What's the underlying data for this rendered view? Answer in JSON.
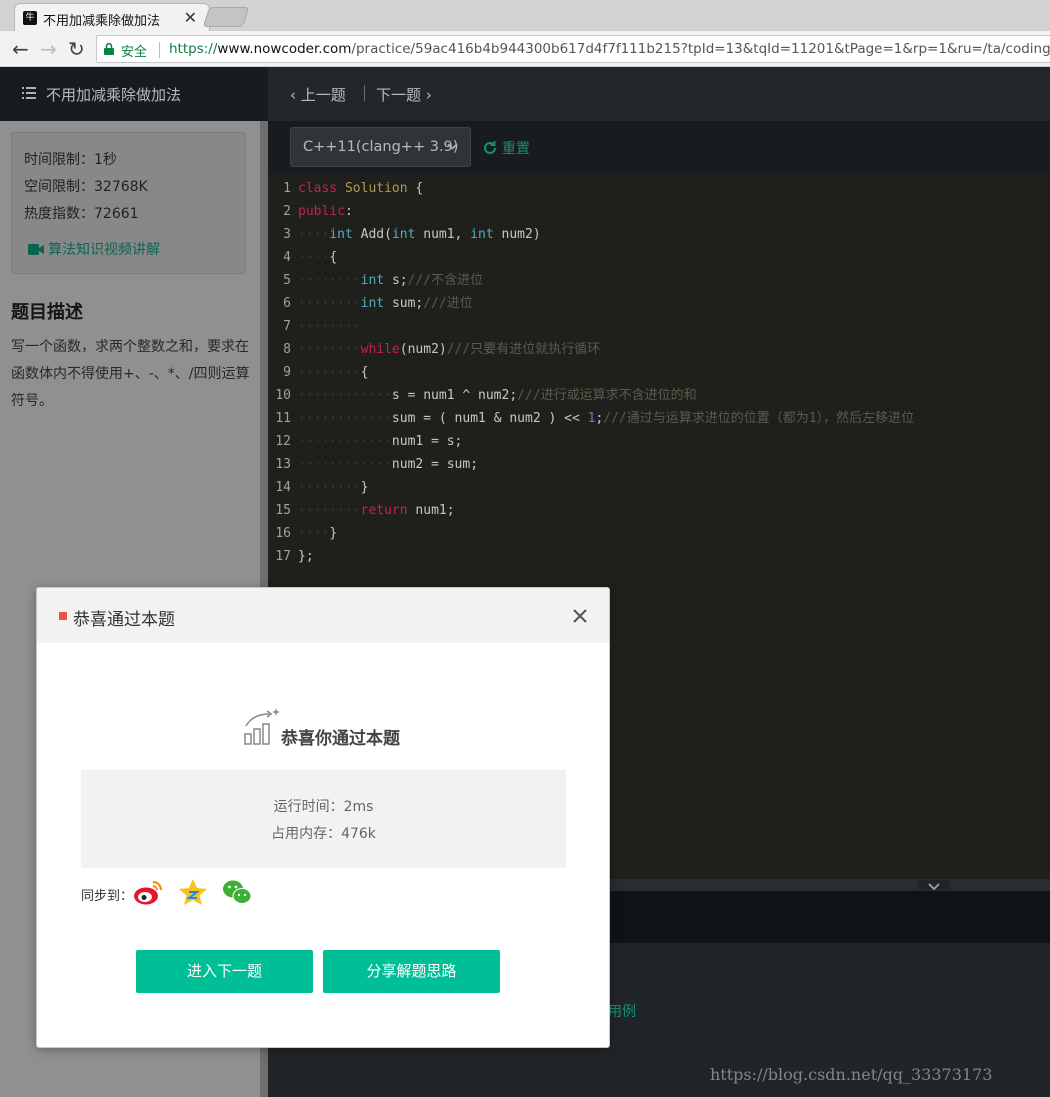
{
  "browser": {
    "tab_title": "不用加减乘除做加法",
    "tab_favicon": "牛",
    "secure_label": "安全",
    "url_scheme": "https://",
    "url_host": "www.nowcoder.com",
    "url_path": "/practice/59ac416b4b944300b617d4f7f111b215?tpId=13&tqId=11201&tPage=1&rp=1&ru=/ta/coding"
  },
  "left_panel": {
    "title": "不用加减乘除做加法",
    "time_limit": "时间限制：1秒",
    "space_limit": "空间限制：32768K",
    "heat_index": "热度指数：72661",
    "video_link": "算法知识视频讲解",
    "desc_title": "题目描述",
    "desc_text": "写一个函数，求两个整数之和，要求在函数体内不得使用+、-、*、/四则运算符号。"
  },
  "right_panel": {
    "prev_label": "上一题",
    "next_label": "下一题",
    "language": "C++11(clang++ 3.9)",
    "reset_label": "重置",
    "example_fragment": "用例"
  },
  "code_lines": [
    [
      [
        "k",
        "class"
      ],
      [
        "d",
        " "
      ],
      [
        "cls",
        "Solution"
      ],
      [
        "d",
        " "
      ],
      [
        "p",
        "{"
      ]
    ],
    [
      [
        "k",
        "public"
      ],
      [
        "p",
        ":"
      ]
    ],
    [
      [
        "d",
        "····"
      ],
      [
        "t",
        "int"
      ],
      [
        "d",
        " "
      ],
      [
        "p",
        "Add("
      ],
      [
        "t",
        "int"
      ],
      [
        "d",
        " "
      ],
      [
        "p",
        "num1,"
      ],
      [
        "d",
        " "
      ],
      [
        "t",
        "int"
      ],
      [
        "d",
        " "
      ],
      [
        "p",
        "num2)"
      ]
    ],
    [
      [
        "d",
        "····"
      ],
      [
        "p",
        "{"
      ]
    ],
    [
      [
        "d",
        "········"
      ],
      [
        "t",
        "int"
      ],
      [
        "d",
        " "
      ],
      [
        "p",
        "s;"
      ],
      [
        "c",
        "///不含进位"
      ]
    ],
    [
      [
        "d",
        "········"
      ],
      [
        "t",
        "int"
      ],
      [
        "d",
        " "
      ],
      [
        "p",
        "sum;"
      ],
      [
        "c",
        "///进位"
      ]
    ],
    [
      [
        "d",
        "········"
      ]
    ],
    [
      [
        "d",
        "········"
      ],
      [
        "k",
        "while"
      ],
      [
        "p",
        "(num2)"
      ],
      [
        "c",
        "///只要有进位就执行循环"
      ]
    ],
    [
      [
        "d",
        "········"
      ],
      [
        "p",
        "{"
      ]
    ],
    [
      [
        "d",
        "············"
      ],
      [
        "p",
        "s"
      ],
      [
        "d",
        " "
      ],
      [
        "p",
        "="
      ],
      [
        "d",
        " "
      ],
      [
        "p",
        "num1"
      ],
      [
        "d",
        " "
      ],
      [
        "p",
        "^"
      ],
      [
        "d",
        " "
      ],
      [
        "p",
        "num2;"
      ],
      [
        "c",
        "///进行或运算求不含进位的和"
      ]
    ],
    [
      [
        "d",
        "············"
      ],
      [
        "p",
        "sum"
      ],
      [
        "d",
        " "
      ],
      [
        "p",
        "="
      ],
      [
        "d",
        " "
      ],
      [
        "p",
        "("
      ],
      [
        "d",
        " "
      ],
      [
        "p",
        "num1"
      ],
      [
        "d",
        " "
      ],
      [
        "p",
        "&"
      ],
      [
        "d",
        " "
      ],
      [
        "p",
        "num2"
      ],
      [
        "d",
        " "
      ],
      [
        "p",
        ")"
      ],
      [
        "d",
        " "
      ],
      [
        "p",
        "<<"
      ],
      [
        "d",
        " "
      ],
      [
        "n",
        "1"
      ],
      [
        "p",
        ";"
      ],
      [
        "c",
        "///通过与运算求进位的位置（都为1），然后左移进位"
      ]
    ],
    [
      [
        "d",
        "············"
      ],
      [
        "p",
        "num1"
      ],
      [
        "d",
        " "
      ],
      [
        "p",
        "="
      ],
      [
        "d",
        " "
      ],
      [
        "p",
        "s;"
      ]
    ],
    [
      [
        "d",
        "············"
      ],
      [
        "p",
        "num2"
      ],
      [
        "d",
        " "
      ],
      [
        "p",
        "="
      ],
      [
        "d",
        " "
      ],
      [
        "p",
        "sum;"
      ]
    ],
    [
      [
        "d",
        "········"
      ],
      [
        "p",
        "}"
      ]
    ],
    [
      [
        "d",
        "········"
      ],
      [
        "k",
        "return"
      ],
      [
        "d",
        " "
      ],
      [
        "p",
        "num1;"
      ]
    ],
    [
      [
        "d",
        "····"
      ],
      [
        "p",
        "}"
      ]
    ],
    [
      [
        "p",
        "};"
      ]
    ]
  ],
  "modal": {
    "title": "恭喜通过本题",
    "success_text": "恭喜你通过本题",
    "run_time": "运行时间：2ms",
    "memory": "占用内存：476k",
    "sync_label": "同步到：",
    "next_button": "进入下一题",
    "share_button": "分享解题思路"
  },
  "watermark": "https://blog.csdn.net/qq_33373173",
  "colors": {
    "accent": "#00bf97",
    "reset_green": "#1ab394",
    "title_mark": "#e8553e"
  },
  "icons": {
    "share_targets": [
      "weibo-icon",
      "qzone-icon",
      "wechat-icon"
    ]
  }
}
